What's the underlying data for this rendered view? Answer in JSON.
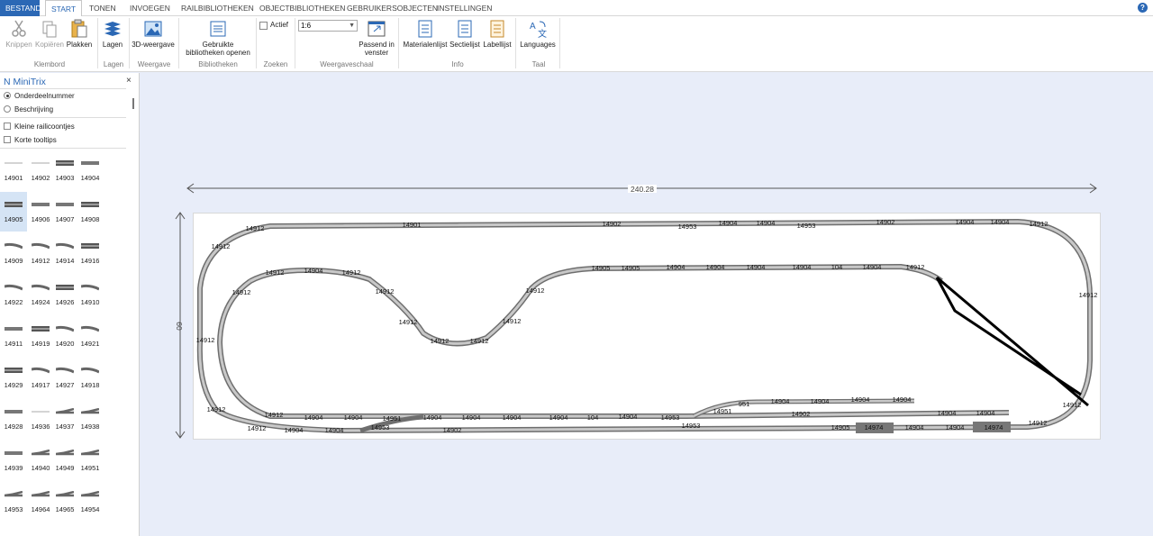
{
  "menu": {
    "tabs": [
      "BESTAND",
      "START",
      "TONEN",
      "INVOEGEN",
      "RAILBIBLIOTHEKEN",
      "OBJECTBIBLIOTHEKEN",
      "GEBRUIKERSOBJECTEN",
      "INSTELLINGEN"
    ],
    "help": "?"
  },
  "ribbon": {
    "knippen": "Knippen",
    "kopieren": "Kopiëren",
    "plakken": "Plakken",
    "lagen": "Lagen",
    "weergave3d": "3D-weergave",
    "bibliotheken_l1": "Gebruikte",
    "bibliotheken_l2": "bibliotheken openen",
    "actief": "Actief",
    "scale": "1:6",
    "passend_l1": "Passend in",
    "passend_l2": "venster",
    "materialenlijst": "Materialenlijst",
    "sectielijst": "Sectielijst",
    "labellijst": "Labellijst",
    "languages": "Languages",
    "groups": {
      "klembord": "Klembord",
      "lagen": "Lagen",
      "weergave": "Weergave",
      "bibliotheken": "Bibliotheken",
      "zoeken": "Zoeken",
      "weergaveschaal": "Weergaveschaal",
      "info": "Info",
      "taal": "Taal"
    }
  },
  "panel": {
    "title": "N MiniTrix",
    "close": "×",
    "radio_partnumber": "Onderdeelnummer",
    "radio_description": "Beschrijving",
    "chk_small_icons": "Kleine railicoontjes",
    "chk_short_tooltips": "Korte tooltips",
    "parts": [
      [
        "14901",
        "14902",
        "14903",
        "14904"
      ],
      [
        "14905",
        "14906",
        "14907",
        "14908"
      ],
      [
        "14909",
        "14912",
        "14914",
        "14916"
      ],
      [
        "14922",
        "14924",
        "14926",
        "14910"
      ],
      [
        "14911",
        "14919",
        "14920",
        "14921"
      ],
      [
        "14929",
        "14917",
        "14927",
        "14918"
      ],
      [
        "14928",
        "14936",
        "14937",
        "14938"
      ],
      [
        "14939",
        "14940",
        "14949",
        "14951"
      ],
      [
        "14953",
        "14964",
        "14965",
        "14954"
      ]
    ]
  },
  "layout": {
    "width_label": "240.28",
    "height_label": "60",
    "track_labels": [
      {
        "t": "14912"
      },
      {
        "t": "14901"
      },
      {
        "t": "14902"
      },
      {
        "t": "14953"
      },
      {
        "t": "14904"
      },
      {
        "t": "14904"
      },
      {
        "t": "14953"
      },
      {
        "t": "14902"
      },
      {
        "t": "14904"
      },
      {
        "t": "14904"
      },
      {
        "t": "14912"
      },
      {
        "t": "14912"
      },
      {
        "t": "14912"
      },
      {
        "t": "14904"
      },
      {
        "t": "14912"
      },
      {
        "t": "14912"
      },
      {
        "t": "14912"
      },
      {
        "t": "14912"
      },
      {
        "t": "14912"
      },
      {
        "t": "14912"
      },
      {
        "t": "14912"
      },
      {
        "t": "14912"
      },
      {
        "t": "14905"
      },
      {
        "t": "14905"
      },
      {
        "t": "14904"
      },
      {
        "t": "14904"
      },
      {
        "t": "14904"
      },
      {
        "t": "14904"
      },
      {
        "t": "104"
      },
      {
        "t": "14904"
      },
      {
        "t": "14912"
      },
      {
        "t": "14912"
      },
      {
        "t": "14912"
      },
      {
        "t": "14912"
      },
      {
        "t": "14904"
      },
      {
        "t": "14904"
      },
      {
        "t": "14951"
      },
      {
        "t": "14904"
      },
      {
        "t": "14904"
      },
      {
        "t": "14904"
      },
      {
        "t": "14904"
      },
      {
        "t": "104"
      },
      {
        "t": "14904"
      },
      {
        "t": "14953"
      },
      {
        "t": "14951"
      },
      {
        "t": "14902"
      },
      {
        "t": "14904"
      },
      {
        "t": "14904"
      },
      {
        "t": "14912"
      },
      {
        "t": "14904"
      },
      {
        "t": "14904"
      },
      {
        "t": "14953"
      },
      {
        "t": "14902"
      },
      {
        "t": "14953"
      },
      {
        "t": "14905"
      },
      {
        "t": "14974"
      },
      {
        "t": "14904"
      },
      {
        "t": "14904"
      },
      {
        "t": "14974"
      },
      {
        "t": "14912"
      },
      {
        "t": "14912"
      },
      {
        "t": "14912"
      },
      {
        "t": "14904"
      },
      {
        "t": "14904"
      },
      {
        "t": "14904"
      },
      {
        "t": "14904"
      },
      {
        "t": "951"
      }
    ]
  }
}
